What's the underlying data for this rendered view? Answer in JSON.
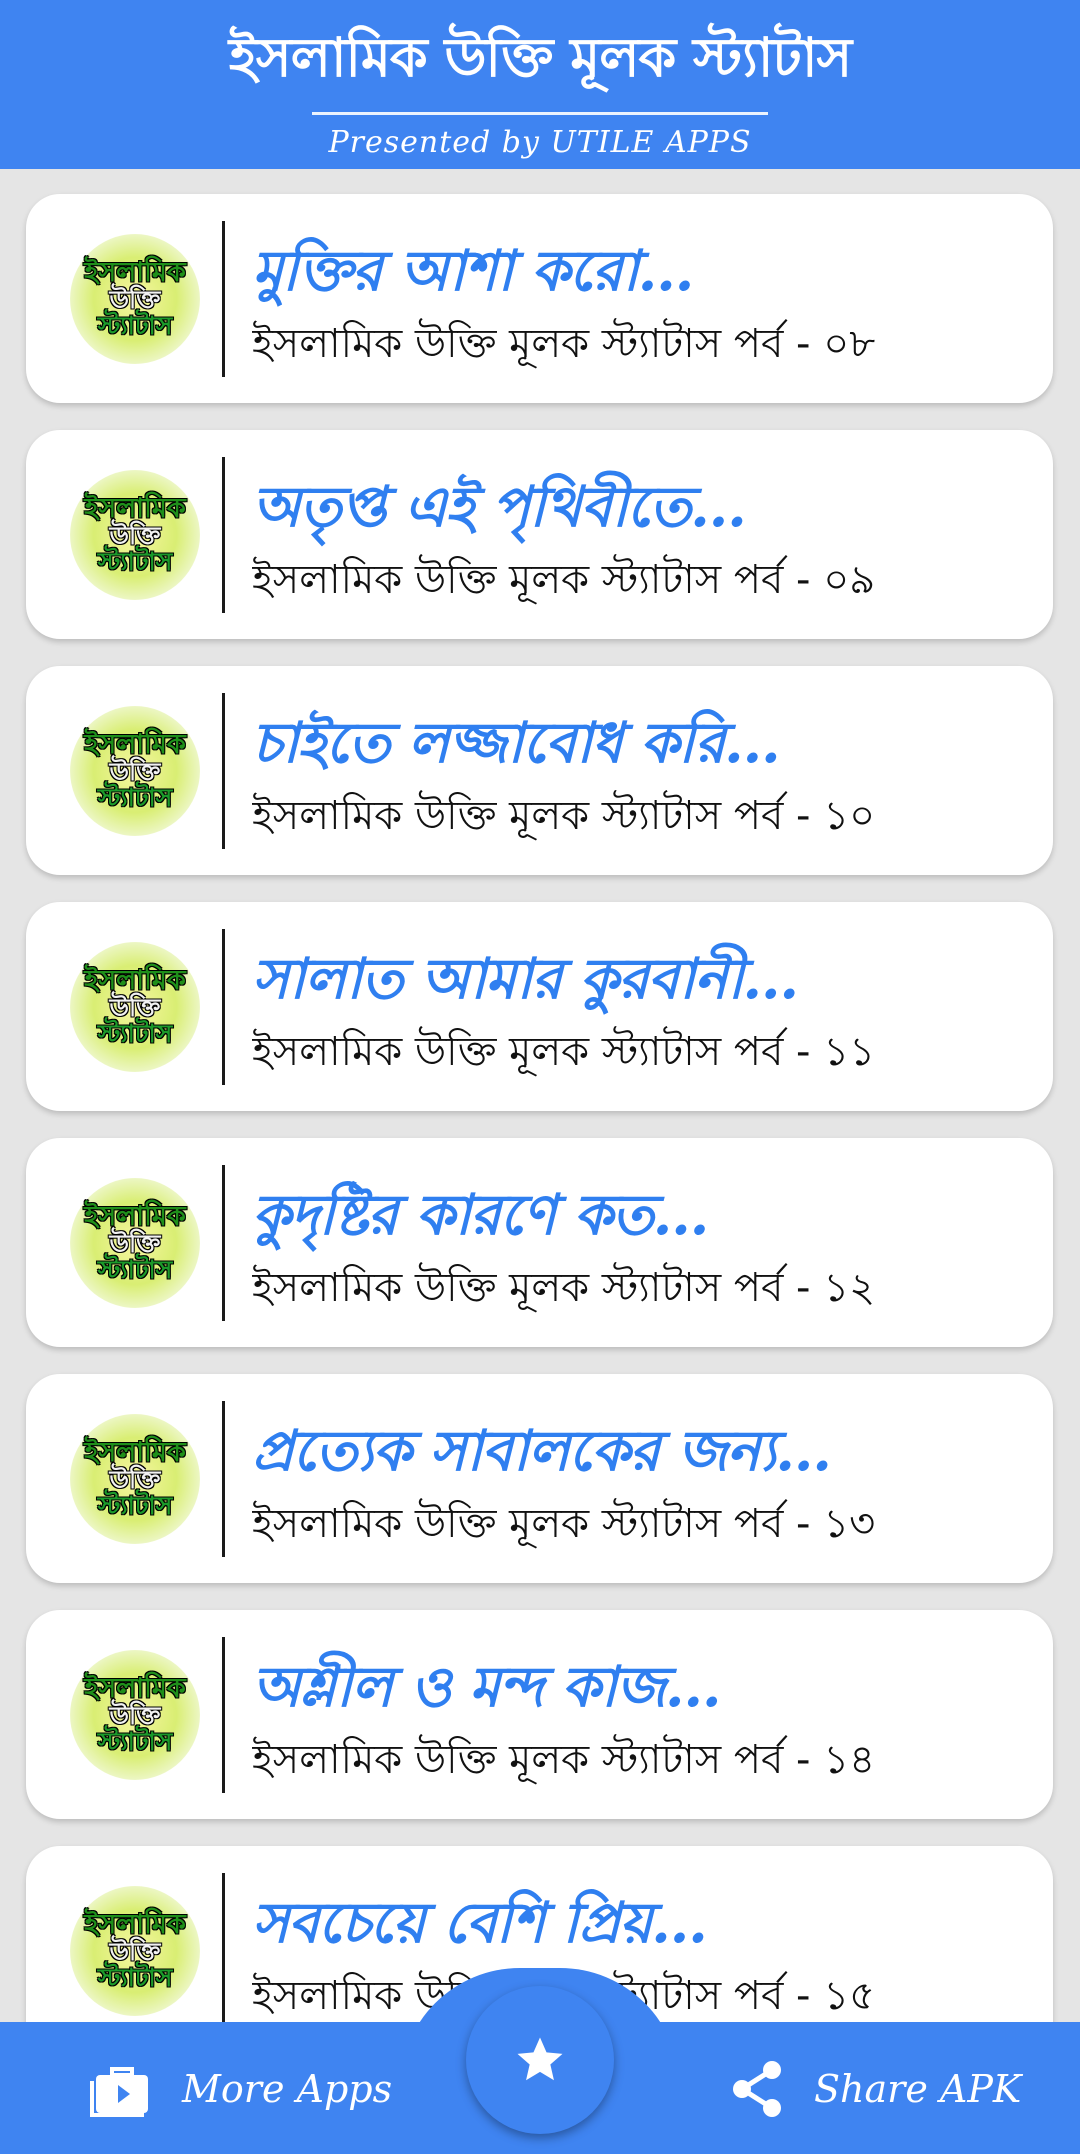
{
  "header": {
    "title": "ইসলামিক উক্তি মূলক স্ট্যাটাস",
    "subtitle": "Presented by UTILE APPS"
  },
  "thumbnail": {
    "line1": "ইসলামিক",
    "line2": "উক্তি",
    "line3": "স্ট্যাটাস"
  },
  "items": [
    {
      "title": "মুক্তির আশা করো...",
      "subtitle": "ইসলামিক উক্তি মূলক স্ট্যাটাস পর্ব - ০৮"
    },
    {
      "title": "অতৃপ্ত এই পৃথিবীতে...",
      "subtitle": "ইসলামিক উক্তি মূলক স্ট্যাটাস পর্ব - ০৯"
    },
    {
      "title": "চাইতে লজ্জাবোধ করি...",
      "subtitle": "ইসলামিক উক্তি মূলক স্ট্যাটাস পর্ব - ১০"
    },
    {
      "title": "সালাত আমার কুরবানী...",
      "subtitle": "ইসলামিক উক্তি মূলক স্ট্যাটাস পর্ব - ১১"
    },
    {
      "title": "কুদৃষ্টির কারণে কত...",
      "subtitle": "ইসলামিক উক্তি মূলক স্ট্যাটাস পর্ব - ১২"
    },
    {
      "title": "প্রত্যেক সাবালকের জন্য...",
      "subtitle": "ইসলামিক উক্তি মূলক স্ট্যাটাস পর্ব - ১৩"
    },
    {
      "title": "অশ্লীল ও মন্দ কাজ...",
      "subtitle": "ইসলামিক উক্তি মূলক স্ট্যাটাস পর্ব - ১৪"
    },
    {
      "title": "সবচেয়ে বেশি প্রিয়...",
      "subtitle": "ইসলামিক উক্তি মূলক স্ট্যাটাস পর্ব - ১৫"
    }
  ],
  "bottom_bar": {
    "more_apps_label": "More Apps",
    "share_label": "Share APK",
    "more_apps_icon": "briefcase-play-icon",
    "fab_icon": "star-icon",
    "share_icon": "share-icon"
  },
  "colors": {
    "primary": "#3f84f1",
    "title_text": "#2f7ff0",
    "background": "#e5e5e5"
  }
}
